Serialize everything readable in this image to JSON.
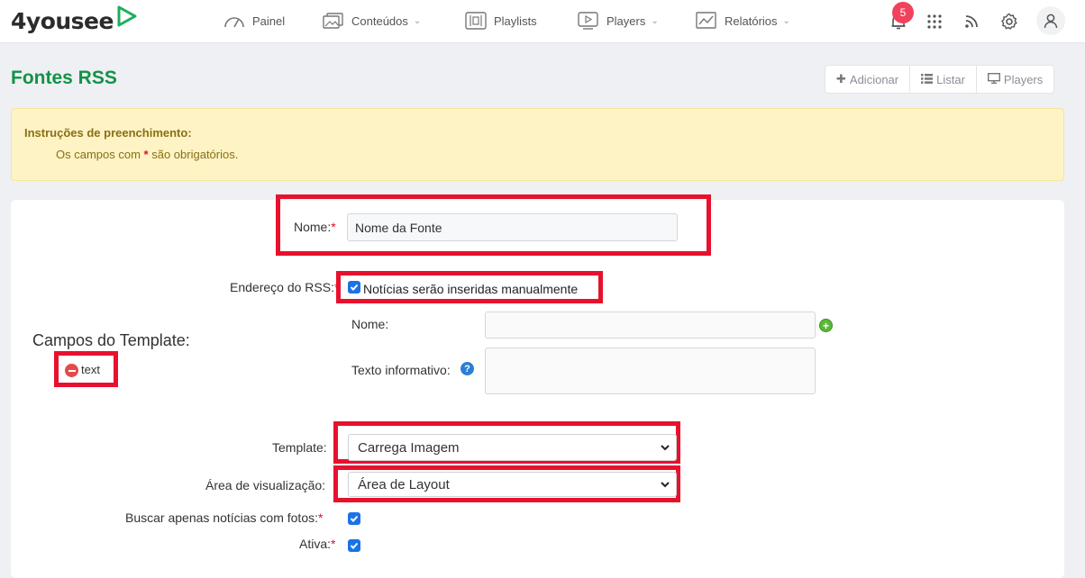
{
  "brand": {
    "name": "4yousee"
  },
  "nav": {
    "items": [
      {
        "label": "Painel",
        "has_caret": false
      },
      {
        "label": "Conteúdos",
        "has_caret": true
      },
      {
        "label": "Playlists",
        "has_caret": false
      },
      {
        "label": "Players",
        "has_caret": true
      },
      {
        "label": "Relatórios",
        "has_caret": true
      }
    ],
    "notification_count": "5"
  },
  "page": {
    "title": "Fontes RSS",
    "actions": {
      "add": "Adicionar",
      "list": "Listar",
      "players": "Players"
    }
  },
  "alert": {
    "title": "Instruções de preenchimento:",
    "text_before": "Os campos com",
    "required_mark": "*",
    "text_after": "são obrigatórios."
  },
  "form": {
    "nome_label": "Nome:",
    "required_mark": "*",
    "nome_value": "Nome da Fonte",
    "rss_label": "Endereço do RSS:",
    "manual_checkbox_label": "Notícias serão inseridas manualmente",
    "manual_checked": true,
    "campos_title": "Campos do Template:",
    "campo_tag": "text",
    "sub_nome_label": "Nome:",
    "sub_nome_value": "",
    "texto_informativo_label": "Texto informativo:",
    "texto_informativo_value": "",
    "template_label": "Template:",
    "template_value": "Carrega Imagem",
    "area_label": "Área de visualização:",
    "area_value": "Área de Layout",
    "fotos_label": "Buscar apenas notícias com fotos:",
    "fotos_checked": true,
    "ativa_label": "Ativa:",
    "ativa_checked": true
  },
  "colors": {
    "brand_green": "#139248",
    "highlight_red": "#e8112d",
    "checkbox_blue": "#1a73e8",
    "alert_bg": "#fdf3c5"
  }
}
